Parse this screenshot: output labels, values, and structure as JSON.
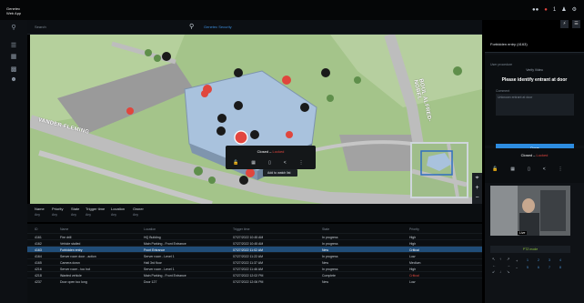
{
  "app": {
    "brand_line1": "Genetec",
    "brand_line2": "Web App"
  },
  "topbar": {
    "icons": [
      "users-icon",
      "alarm-icon",
      "user-icon",
      "settings-icon"
    ],
    "alert_badge": "1",
    "alert_color": "#e2463f"
  },
  "search": {
    "placeholder": "Search",
    "source_label": "Genetec Security"
  },
  "map": {
    "road_labels": [
      "VANDER FLEMING",
      "BOUL ALFRED-NOBEL"
    ],
    "building_color": "#a9c2dd",
    "grass_color": "#a4c48a",
    "road_color": "#b8b8b8"
  },
  "popup": {
    "status_text": "Closed",
    "lock_text": "Locked",
    "actions": [
      "unlock-icon",
      "calendar-icon",
      "door-icon",
      "share-icon",
      "more-icon"
    ],
    "context_item": "Add to watch list"
  },
  "filters": [
    {
      "label": "Name",
      "value": "Any"
    },
    {
      "label": "Priority",
      "value": "Any"
    },
    {
      "label": "State",
      "value": "Any"
    },
    {
      "label": "Trigger time",
      "value": "Any"
    },
    {
      "label": "Location",
      "value": "Any"
    },
    {
      "label": "Owner",
      "value": "Any"
    }
  ],
  "table": {
    "columns": [
      "ID",
      "Name",
      "Location",
      "Trigger time",
      "State",
      "Priority"
    ],
    "rows": [
      {
        "id": "4161",
        "name": "Fire drill",
        "location": "HQ Building",
        "time": "07/27/2022 10:45 AM",
        "state": "In progress",
        "priority": "High"
      },
      {
        "id": "4162",
        "name": "Vehicle stalled",
        "location": "Main Parking - Front Entrance",
        "time": "07/27/2022 10:45 AM",
        "state": "In progress",
        "priority": "High"
      },
      {
        "id": "4163",
        "name": "Forbidden entry",
        "location": "Front Entrance",
        "time": "07/27/2022 11:02 AM",
        "state": "New",
        "priority": "Critical"
      },
      {
        "id": "4164",
        "name": "Server room door - action",
        "location": "Server room - Level 1",
        "time": "07/27/2022 11:22 AM",
        "state": "In progress",
        "priority": "Low"
      },
      {
        "id": "4165",
        "name": "Camera down",
        "location": "Hall 3rd floor",
        "time": "07/27/2022 11:37 AM",
        "state": "New",
        "priority": "Medium"
      },
      {
        "id": "4216",
        "name": "Server room - too hot",
        "location": "Server room - Level 1",
        "time": "07/27/2022 11:46 AM",
        "state": "In progress",
        "priority": "High"
      },
      {
        "id": "4218",
        "name": "Wanted vehicle",
        "location": "Main Parking - Front Entrance",
        "time": "07/27/2022 12:02 PM",
        "state": "Complete",
        "priority": "Critical"
      },
      {
        "id": "4237",
        "name": "Door open too long",
        "location": "Door 127",
        "time": "07/27/2022 12:06 PM",
        "state": "New",
        "priority": "Low"
      }
    ]
  },
  "right_panel": {
    "title": "Forbidden entry (4163)",
    "section_label": "User procedure",
    "verify_label": "Verify Video",
    "message": "Please identify entrant at door",
    "comment_label": "Comment",
    "comment_placeholder": "Unknown entrant at door",
    "done_label": "Done",
    "door_status": "Closed",
    "door_lock": "Locked",
    "video_live": "Live",
    "ptz_label": "PTZ mode",
    "ptz_numbers": [
      "1",
      "2",
      "3",
      "4",
      "5",
      "6",
      "7",
      "8"
    ]
  }
}
